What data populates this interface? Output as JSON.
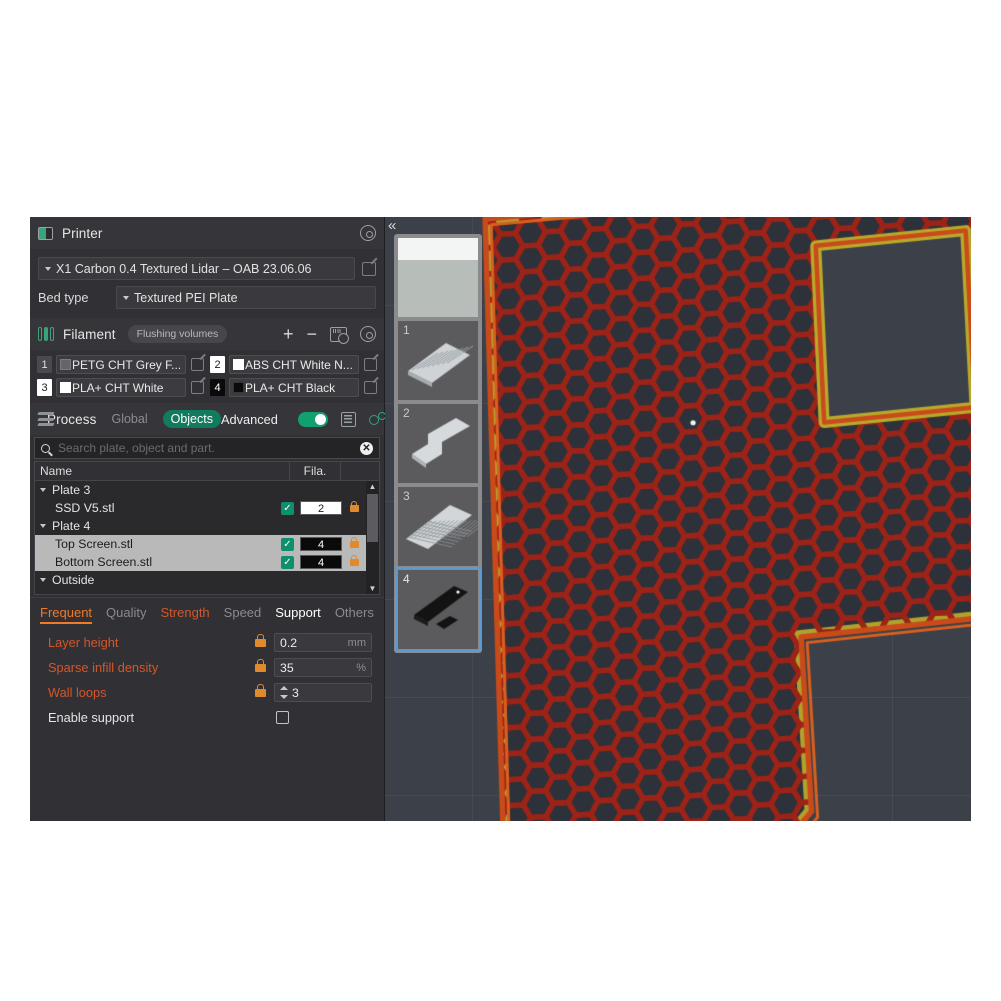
{
  "printer": {
    "section_title": "Printer",
    "gear_icon": "gear-icon",
    "icon": "printer-icon",
    "preset": "X1 Carbon 0.4 Textured Lidar – OAB 23.06.06",
    "bed_type_label": "Bed type",
    "bed_type_value": "Textured PEI Plate",
    "edit_icon": "edit-icon"
  },
  "filament": {
    "section_title": "Filament",
    "icon": "filament-icon",
    "flushing_volumes_label": "Flushing volumes",
    "add_label": "+",
    "remove_label": "−",
    "ams_icon": "ams-icon",
    "gear_icon": "gear-icon",
    "slots": [
      {
        "index": "1",
        "name": "PETG CHT Grey F...",
        "color": "#6e6e72",
        "idx_bg": "#4a4a4e",
        "idx_fg": "#e0e0e0"
      },
      {
        "index": "2",
        "name": "ABS CHT White N...",
        "color": "#ffffff",
        "idx_bg": "#ffffff",
        "idx_fg": "#1c1c1c"
      },
      {
        "index": "3",
        "name": "PLA+ CHT White",
        "color": "#ffffff",
        "idx_bg": "#ffffff",
        "idx_fg": "#1c1c1c"
      },
      {
        "index": "4",
        "name": "PLA+ CHT Black",
        "color": "#0a0a0a",
        "idx_bg": "#0a0a0a",
        "idx_fg": "#ffffff"
      }
    ]
  },
  "process": {
    "section_title": "Process",
    "icon": "process-icon",
    "scope_global": "Global",
    "scope_objects": "Objects",
    "advanced_label": "Advanced",
    "advanced_on": true,
    "list_icon": "list-icon",
    "gears_icon": "gears-icon",
    "accent_green": "#12a06f"
  },
  "search": {
    "placeholder": "Search plate, object and part.",
    "value": "",
    "icon": "search-icon",
    "clear_icon": "close-icon"
  },
  "object_list": {
    "columns": {
      "name": "Name",
      "fila": "Fila."
    },
    "scroll_up": "▲",
    "scroll_down": "▼",
    "rows": [
      {
        "label": "Plate 3",
        "type": "group",
        "indent": 0,
        "expander": true,
        "checked": false,
        "fila": null,
        "lock": false,
        "selected": false
      },
      {
        "label": "SSD V5.stl",
        "type": "object",
        "indent": 1,
        "expander": false,
        "checked": true,
        "fila": "2",
        "fila_bg": "#ffffff",
        "fila_fg": "#1c1c1c",
        "lock": true,
        "selected": false
      },
      {
        "label": "Plate 4",
        "type": "group",
        "indent": 0,
        "expander": true,
        "checked": false,
        "fila": null,
        "lock": false,
        "selected": false
      },
      {
        "label": "Top Screen.stl",
        "type": "object",
        "indent": 1,
        "expander": false,
        "checked": true,
        "fila": "4",
        "fila_bg": "#0a0a0a",
        "fila_fg": "#ffffff",
        "lock": true,
        "selected": true
      },
      {
        "label": "Bottom Screen.stl",
        "type": "object",
        "indent": 1,
        "expander": false,
        "checked": true,
        "fila": "4",
        "fila_bg": "#0a0a0a",
        "fila_fg": "#ffffff",
        "lock": true,
        "selected": true
      },
      {
        "label": "Outside",
        "type": "group",
        "indent": 0,
        "expander": true,
        "checked": false,
        "fila": null,
        "lock": false,
        "selected": false
      }
    ]
  },
  "param_tabs": [
    {
      "label": "Frequent",
      "state": "active"
    },
    {
      "label": "Quality",
      "state": "dim"
    },
    {
      "label": "Strength",
      "state": "warm"
    },
    {
      "label": "Speed",
      "state": "dim"
    },
    {
      "label": "Support",
      "state": "bright"
    },
    {
      "label": "Others",
      "state": "dim"
    }
  ],
  "params": [
    {
      "name": "Layer height",
      "style": "warn",
      "lock": true,
      "value": "0.2",
      "unit": "mm",
      "spinner": false,
      "kind": "text"
    },
    {
      "name": "Sparse infill density",
      "style": "warn",
      "lock": true,
      "value": "35",
      "unit": "%",
      "spinner": false,
      "kind": "text"
    },
    {
      "name": "Wall loops",
      "style": "warn",
      "lock": true,
      "value": "3",
      "unit": "",
      "spinner": true,
      "kind": "text"
    },
    {
      "name": "Enable support",
      "style": "norm",
      "lock": false,
      "value": "",
      "unit": "",
      "spinner": false,
      "kind": "checkbox",
      "checked": false
    }
  ],
  "viewport": {
    "collapse_icon": "chevron-double-left-icon",
    "background": "#3b4049",
    "plates": [
      {
        "number": "",
        "selected": false,
        "kind": "plate-top"
      },
      {
        "number": "1",
        "selected": false,
        "kind": "model"
      },
      {
        "number": "2",
        "selected": false,
        "kind": "model"
      },
      {
        "number": "3",
        "selected": false,
        "kind": "model"
      },
      {
        "number": "4",
        "selected": true,
        "kind": "model"
      }
    ],
    "gcode_preview": {
      "description": "honeycomb-infill-gcode-preview",
      "wall_color": "#c94b1a",
      "infill_color": "#9c2318",
      "solid_color": "#b9a92b",
      "gap_color": "#2c313a"
    }
  }
}
